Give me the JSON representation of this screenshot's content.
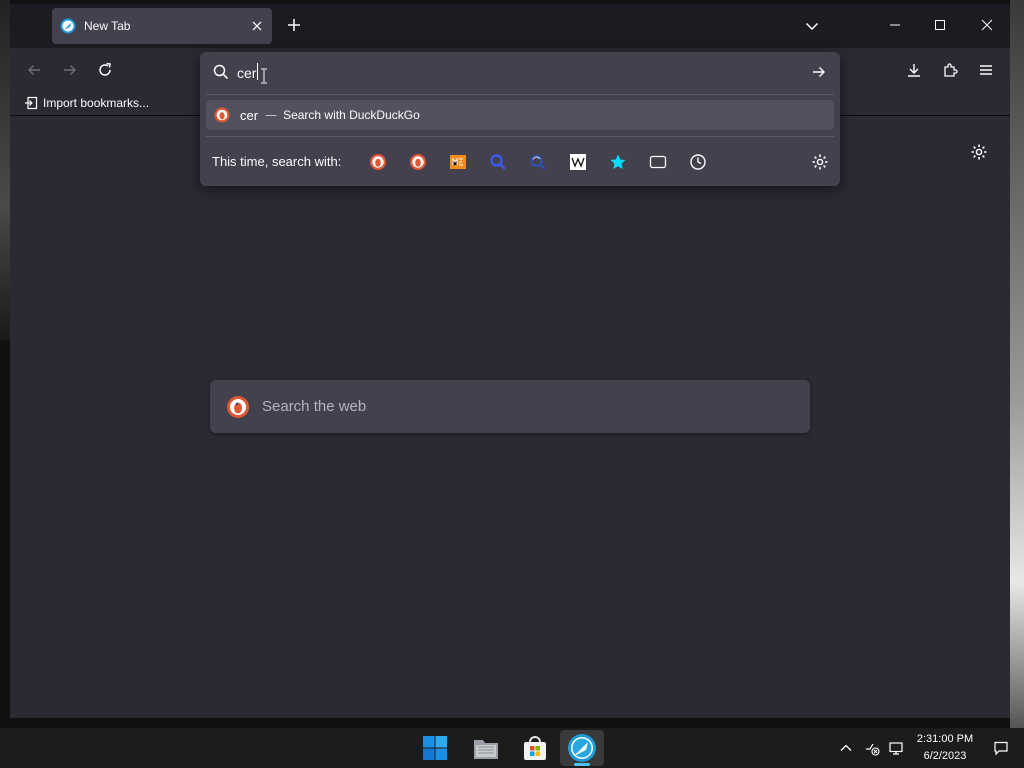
{
  "tab": {
    "title": "New Tab"
  },
  "bookmarks_bar": {
    "import_label": "Import bookmarks..."
  },
  "urlbar": {
    "value": "cer",
    "suggestion": {
      "query": "cer",
      "separator": "—",
      "action": "Search with DuckDuckGo"
    },
    "one_off": {
      "label": "This time, search with:",
      "engines": [
        "duckduckgo",
        "duckduckgo-alt",
        "metager",
        "search-blue",
        "searx",
        "wikipedia",
        "bookmarks",
        "tabs",
        "history"
      ]
    }
  },
  "new_tab": {
    "search_placeholder": "Search the web"
  },
  "taskbar": {
    "time": "2:31:00 PM",
    "date": "6/2/2023"
  },
  "colors": {
    "accent": "#00ddff",
    "ddg_orange": "#de5833",
    "window_bg": "#2b2a33",
    "panel_bg": "#42414d"
  }
}
